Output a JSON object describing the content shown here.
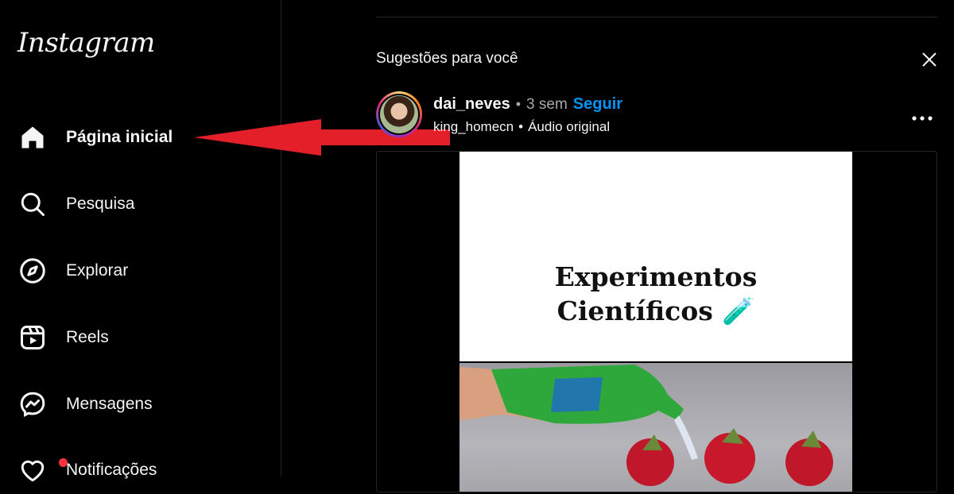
{
  "app": {
    "logo_text": "Instagram"
  },
  "sidebar": {
    "items": [
      {
        "label": "Página inicial",
        "icon": "home-icon",
        "active": true
      },
      {
        "label": "Pesquisa",
        "icon": "search-icon",
        "active": false
      },
      {
        "label": "Explorar",
        "icon": "compass-icon",
        "active": false
      },
      {
        "label": "Reels",
        "icon": "reels-icon",
        "active": false
      },
      {
        "label": "Mensagens",
        "icon": "messenger-icon",
        "active": false
      },
      {
        "label": "Notificações",
        "icon": "heart-icon",
        "active": false,
        "has_badge": true
      }
    ]
  },
  "annotation": {
    "arrow_color": "#e3202a",
    "points_to": "Página inicial"
  },
  "feed": {
    "suggestions_title": "Sugestões para você",
    "post": {
      "username": "dai_neves",
      "separator": "•",
      "time": "3 sem",
      "follow_label": "Seguir",
      "audio_user": "king_homecn",
      "audio_label": "Áudio original",
      "media_title_line1": "Experimentos",
      "media_title_line2": "Científicos",
      "media_emoji": "🧪"
    }
  },
  "colors": {
    "background": "#000000",
    "text": "#f5f5f5",
    "muted": "#a8a8a8",
    "link": "#0095f6",
    "badge": "#ff3040"
  }
}
